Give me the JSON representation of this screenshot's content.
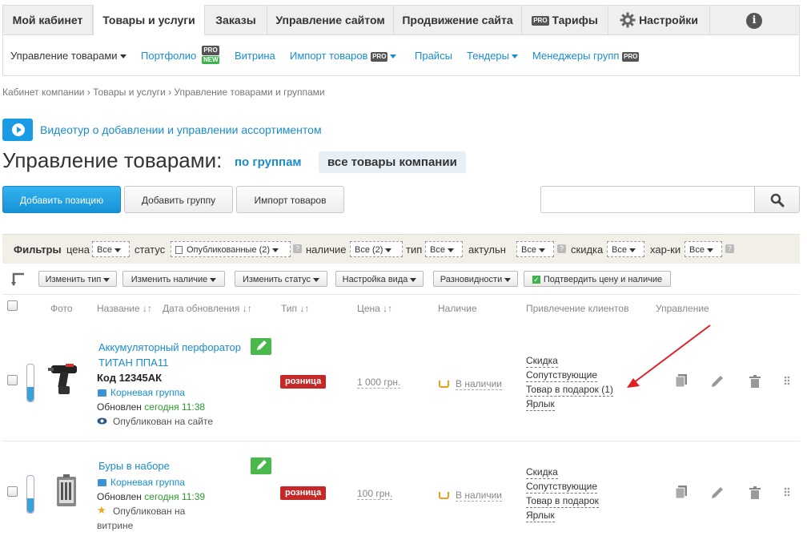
{
  "topnav": {
    "tabs": [
      "Мой кабинет",
      "Товары и услуги",
      "Заказы",
      "Управление сайтом",
      "Продвижение сайта",
      "Тарифы",
      "Настройки"
    ],
    "pro": "PRO",
    "info": "i"
  },
  "subnav": {
    "items": [
      "Управление товарами",
      "Портфолио",
      "Витрина",
      "Импорт товаров",
      "Прайсы",
      "Тендеры",
      "Менеджеры групп"
    ],
    "pro": "PRO",
    "new": "NEW"
  },
  "breadcrumb": "Кабинет компании › Товары и услуги › Управление товарами и группами",
  "video_link": "Видеотур о добавлении и управлении ассортиментом",
  "page": {
    "title": "Управление товарами:",
    "view_groups": "по группам",
    "view_all": "все товары компании"
  },
  "toolbar": {
    "add_position": "Добавить позицию",
    "add_group": "Добавить группу",
    "import": "Импорт товаров",
    "search_placeholder": ""
  },
  "filters": {
    "title": "Фильтры",
    "price": {
      "label": "цена",
      "value": "Все"
    },
    "status": {
      "label": "статус",
      "value": "Опубликованные (2)"
    },
    "availability": {
      "label": "наличие",
      "value": "Все (2)"
    },
    "type": {
      "label": "тип",
      "value": "Все"
    },
    "actual": {
      "label": "актульн",
      "value": "Все"
    },
    "discount": {
      "label": "скидка",
      "value": "Все"
    },
    "chars": {
      "label": "хар-ки",
      "value": "Все"
    },
    "help": "?"
  },
  "actions": {
    "change_type": "Изменить тип",
    "change_availability": "Изменить наличие",
    "change_status": "Изменить статус",
    "view_settings": "Настройка вида",
    "variants": "Разновидности",
    "confirm": "Подтвердить цену и наличие"
  },
  "columns": {
    "photo": "Фото",
    "name": "Название ↓↑",
    "updated": "Дата обновления ↓↑",
    "type": "Тип ↓↑",
    "price": "Цена ↓↑",
    "availability": "Наличие",
    "promotion": "Привлечение клиентов",
    "manage": "Управление"
  },
  "products": [
    {
      "name_line1": "Аккумуляторный перфоратор",
      "name_line2": "ТИТАН ППА11",
      "code": "Код 12345АК",
      "group": "Корневая группа",
      "updated_prefix": "Обновлен",
      "updated_time": "сегодня 11:38",
      "published_line1": "Опубликован на сайте",
      "published_line2": "",
      "type_badge": "розница",
      "price": "1 000 грн.",
      "availability": "В наличии",
      "promo": [
        "Скидка",
        "Сопутствующие",
        "Товар в подарок (1)",
        "Ярлык"
      ]
    },
    {
      "name_line1": "Буры в наборе",
      "name_line2": "",
      "code": "",
      "group": "Корневая группа",
      "updated_prefix": "Обновлен",
      "updated_time": "сегодня 11:39",
      "published_line1": "Опубликован на",
      "published_line2": "витрине",
      "type_badge": "розница",
      "price": "100 грн.",
      "availability": "В наличии",
      "promo": [
        "Скидка",
        "Сопутствующие",
        "Товар в подарок",
        "Ярлык"
      ]
    }
  ],
  "colors": {
    "accent": "#1a8ccf",
    "badge": "#c62828",
    "annotation": "#e02020",
    "edit": "#4bb84b"
  }
}
